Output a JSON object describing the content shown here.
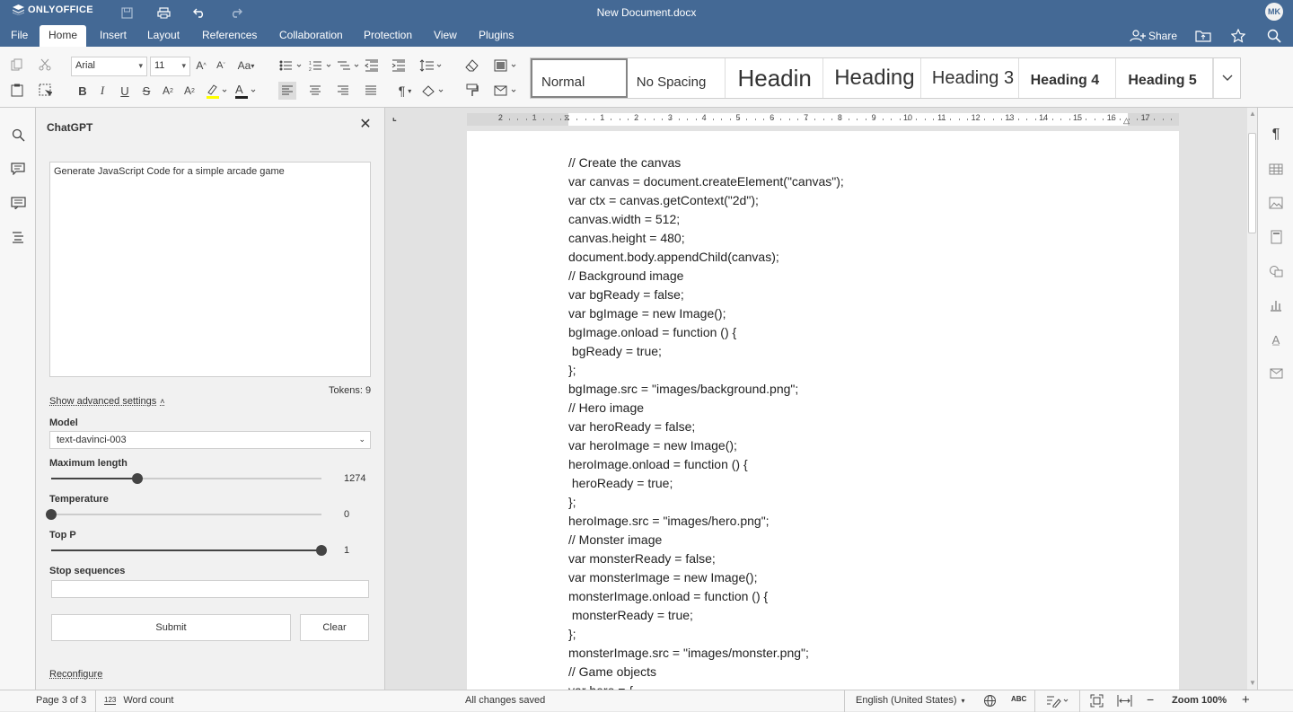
{
  "app": {
    "logo": "ONLYOFFICE",
    "doc_title": "New Document.docx",
    "user_initials": "MK"
  },
  "menu": {
    "tabs": [
      "File",
      "Home",
      "Insert",
      "Layout",
      "References",
      "Collaboration",
      "Protection",
      "View",
      "Plugins"
    ],
    "active": "Home",
    "share": "Share"
  },
  "toolbar": {
    "font": "Arial",
    "size": "11"
  },
  "styles": [
    "Normal",
    "No Spacing",
    "Headin",
    "Heading",
    "Heading 3",
    "Heading 4",
    "Heading 5"
  ],
  "panel": {
    "title": "ChatGPT",
    "prompt": "Generate JavaScript Code for a simple arcade game",
    "tokens": "Tokens: 9",
    "advanced": "Show advanced settings",
    "model_label": "Model",
    "model_value": "text-davinci-003",
    "maxlen_label": "Maximum length",
    "maxlen_value": "1274",
    "maxlen_frac": 0.32,
    "temp_label": "Temperature",
    "temp_value": "0",
    "temp_frac": 0.0,
    "topp_label": "Top P",
    "topp_value": "1",
    "topp_frac": 1.0,
    "stop_label": "Stop sequences",
    "submit": "Submit",
    "clear": "Clear",
    "reconfigure": "Reconfigure"
  },
  "ruler_numbers": [
    "2",
    "1",
    "1",
    "2",
    "3",
    "4",
    "5",
    "6",
    "7",
    "8",
    "9",
    "10",
    "11",
    "12",
    "13",
    "14",
    "15",
    "16",
    "17"
  ],
  "code": [
    "// Create the canvas",
    "var canvas = document.createElement(\"canvas\");",
    "var ctx = canvas.getContext(\"2d\");",
    "canvas.width = 512;",
    "canvas.height = 480;",
    "document.body.appendChild(canvas);",
    "// Background image",
    "var bgReady = false;",
    "var bgImage = new Image();",
    "bgImage.onload = function () {",
    " bgReady = true;",
    "};",
    "bgImage.src = \"images/background.png\";",
    "// Hero image",
    "var heroReady = false;",
    "var heroImage = new Image();",
    "heroImage.onload = function () {",
    " heroReady = true;",
    "};",
    "heroImage.src = \"images/hero.png\";",
    "// Monster image",
    "var monsterReady = false;",
    "var monsterImage = new Image();",
    "monsterImage.onload = function () {",
    " monsterReady = true;",
    "};",
    "monsterImage.src = \"images/monster.png\";",
    "// Game objects",
    "var hero = {"
  ],
  "status": {
    "page": "Page 3 of 3",
    "word_count": "Word count",
    "saved": "All changes saved",
    "language": "English (United States)",
    "zoom": "Zoom 100%"
  }
}
